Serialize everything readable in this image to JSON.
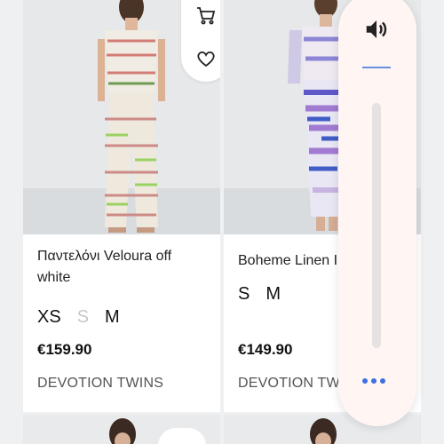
{
  "products": [
    {
      "title": "Παντελόνι Veloura off white",
      "sizes": [
        {
          "label": "XS",
          "available": true
        },
        {
          "label": "S",
          "available": false
        },
        {
          "label": "M",
          "available": true
        }
      ],
      "price": "€159.90",
      "brand": "DEVOTION TWINS"
    },
    {
      "title": "Boheme Linen I",
      "sizes": [
        {
          "label": "S",
          "available": true
        },
        {
          "label": "M",
          "available": true
        }
      ],
      "price": "€149.90",
      "brand": "DEVOTION TWI"
    }
  ],
  "icons": {
    "cart": "cart-icon",
    "wishlist": "heart-icon",
    "volume": "speaker-icon",
    "more": "more-dots-icon"
  },
  "volume": {
    "level": 0
  },
  "colors": {
    "accent": "#3f6fe0",
    "panel": "#fff6f4"
  }
}
